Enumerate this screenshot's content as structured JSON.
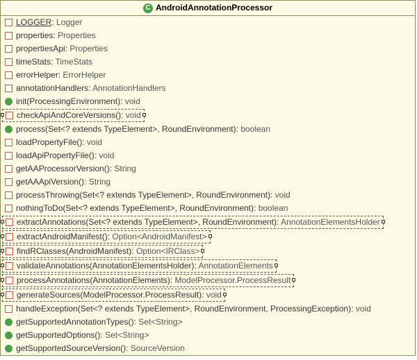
{
  "class_name": "AndroidAnnotationProcessor",
  "members": [
    {
      "kind": "field",
      "selected": false,
      "underline": true,
      "name": "LOGGER",
      "sig": "",
      "ret": "Logger"
    },
    {
      "kind": "field",
      "selected": false,
      "underline": false,
      "name": "properties",
      "sig": "",
      "ret": "Properties"
    },
    {
      "kind": "field",
      "selected": false,
      "underline": false,
      "name": "propertiesApi",
      "sig": "",
      "ret": "Properties"
    },
    {
      "kind": "field",
      "selected": false,
      "underline": false,
      "name": "timeStats",
      "sig": "",
      "ret": "TimeStats"
    },
    {
      "kind": "field",
      "selected": false,
      "underline": false,
      "name": "errorHelper",
      "sig": "",
      "ret": "ErrorHelper"
    },
    {
      "kind": "field",
      "selected": false,
      "underline": false,
      "name": "annotationHandlers",
      "sig": "",
      "ret": "AnnotationHandlers"
    },
    {
      "kind": "method_pub",
      "selected": false,
      "underline": false,
      "name": "init",
      "sig": "(ProcessingEnvironment)",
      "ret": "void"
    },
    {
      "kind": "method_priv",
      "selected": true,
      "underline": false,
      "name": "checkApiAndCoreVersions",
      "sig": "()",
      "ret": "void"
    },
    {
      "kind": "method_pub",
      "selected": false,
      "underline": false,
      "name": "process",
      "sig": "(Set<? extends TypeElement>, RoundEnvironment)",
      "ret": "boolean"
    },
    {
      "kind": "method_priv",
      "selected": false,
      "underline": false,
      "name": "loadPropertyFile",
      "sig": "()",
      "ret": "void"
    },
    {
      "kind": "method_priv",
      "selected": false,
      "underline": false,
      "name": "loadApiPropertyFile",
      "sig": "()",
      "ret": "void"
    },
    {
      "kind": "method_priv",
      "selected": false,
      "underline": false,
      "name": "getAAProcessorVersion",
      "sig": "()",
      "ret": "String"
    },
    {
      "kind": "method_priv",
      "selected": false,
      "underline": false,
      "name": "getAAApiVersion",
      "sig": "()",
      "ret": "String"
    },
    {
      "kind": "method_priv",
      "selected": false,
      "underline": false,
      "name": "processThrowing",
      "sig": "(Set<? extends TypeElement>, RoundEnvironment)",
      "ret": "void"
    },
    {
      "kind": "method_priv",
      "selected": false,
      "underline": false,
      "name": "nothingToDo",
      "sig": "(Set<? extends TypeElement>, RoundEnvironment)",
      "ret": "boolean"
    },
    {
      "kind": "method_priv",
      "selected": true,
      "underline": false,
      "name": "extractAnnotations",
      "sig": "(Set<? extends TypeElement>, RoundEnvironment)",
      "ret": "AnnotationElementsHolder"
    },
    {
      "kind": "method_priv",
      "selected": true,
      "underline": false,
      "name": "extractAndroidManifest",
      "sig": "()",
      "ret": "Option<AndroidManifest>"
    },
    {
      "kind": "method_priv",
      "selected": true,
      "underline": false,
      "name": "findRClasses",
      "sig": "(AndroidManifest)",
      "ret": "Option<IRClass>"
    },
    {
      "kind": "method_priv",
      "selected": true,
      "underline": false,
      "name": "validateAnnotations",
      "sig": "(AnnotationElementsHolder)",
      "ret": "AnnotationElements"
    },
    {
      "kind": "method_priv",
      "selected": true,
      "underline": false,
      "name": "processAnnotations",
      "sig": "(AnnotationElements)",
      "ret": "ModelProcessor.ProcessResult"
    },
    {
      "kind": "method_priv",
      "selected": true,
      "underline": false,
      "name": "generateSources",
      "sig": "(ModelProcessor.ProcessResult)",
      "ret": "void"
    },
    {
      "kind": "method_priv",
      "selected": false,
      "underline": false,
      "name": "handleException",
      "sig": "(Set<? extends TypeElement>, RoundEnvironment, ProcessingException)",
      "ret": "void"
    },
    {
      "kind": "method_pub",
      "selected": false,
      "underline": false,
      "name": "getSupportedAnnotationTypes",
      "sig": "()",
      "ret": "Set<String>"
    },
    {
      "kind": "method_pub",
      "selected": false,
      "underline": false,
      "name": "getSupportedOptions",
      "sig": "()",
      "ret": "Set<String>"
    },
    {
      "kind": "method_pub",
      "selected": false,
      "underline": false,
      "name": "getSupportedSourceVersion",
      "sig": "()",
      "ret": "SourceVersion"
    }
  ]
}
